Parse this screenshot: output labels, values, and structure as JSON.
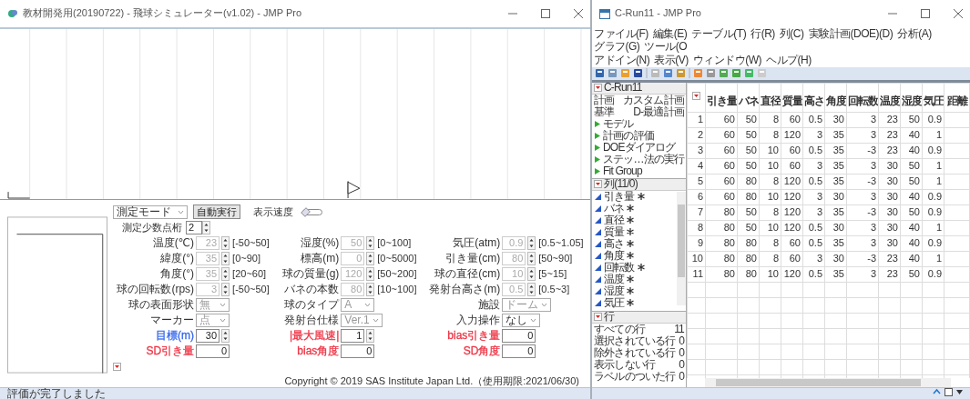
{
  "left_window": {
    "title": "教材開発用(20190722) - 飛球シミュレーター(v1.02) - JMP Pro",
    "toolbar": {
      "mode": "測定モード",
      "auto_run": "自動実行",
      "speed_label": "表示速度",
      "speed": {
        "level": 0.1
      }
    },
    "decimals": {
      "label": "測定少数点桁",
      "value": "2"
    },
    "params": [
      [
        {
          "kind": "spin",
          "label": "温度(℃)",
          "value": "23",
          "range": "[-50~50]",
          "disabled": true
        },
        {
          "kind": "spin",
          "label": "湿度(%)",
          "value": "50",
          "range": "[0~100]",
          "disabled": true
        },
        {
          "kind": "spin",
          "label": "気圧(atm)",
          "value": "0.9",
          "range": "[0.5~1.05]",
          "disabled": true
        }
      ],
      [
        {
          "kind": "spin",
          "label": "緯度(°)",
          "value": "35",
          "range": "[0~90]",
          "disabled": true
        },
        {
          "kind": "spin",
          "label": "標高(m)",
          "value": "0",
          "range": "[0~5000]",
          "disabled": true
        },
        {
          "kind": "spin",
          "label": "引き量(cm)",
          "value": "80",
          "range": "[50~90]",
          "disabled": true
        }
      ],
      [
        {
          "kind": "spin",
          "label": "角度(°)",
          "value": "35",
          "range": "[20~60]",
          "disabled": true
        },
        {
          "kind": "spin",
          "label": "球の質量(g)",
          "value": "120",
          "range": "[50~200]",
          "disabled": true
        },
        {
          "kind": "spin",
          "label": "球の直径(cm)",
          "value": "10",
          "range": "[5~15]",
          "disabled": true
        }
      ],
      [
        {
          "kind": "spin",
          "label": "球の回転数(rps)",
          "value": "3",
          "range": "[-50~50]",
          "disabled": true
        },
        {
          "kind": "spin",
          "label": "バネの本数",
          "value": "80",
          "range": "[10~100]",
          "disabled": true
        },
        {
          "kind": "spin",
          "label": "発射台高さ(m)",
          "value": "0.5",
          "range": "[0.5~3]",
          "disabled": true
        }
      ],
      [
        {
          "kind": "select",
          "label": "球の表面形状",
          "value": "無",
          "disabled": true
        },
        {
          "kind": "select",
          "label": "球のタイプ",
          "value": "A",
          "disabled": true
        },
        {
          "kind": "select",
          "label": "施設",
          "value": "ドーム",
          "disabled": true
        }
      ],
      [
        {
          "kind": "select",
          "label": "マーカー",
          "value": "点",
          "disabled": true
        },
        {
          "kind": "select",
          "label": "発射台仕様",
          "value": "Ver.1",
          "disabled": true
        },
        {
          "kind": "select",
          "label": "入力操作",
          "value": "なし",
          "disabled": false
        }
      ],
      [
        {
          "kind": "spin",
          "label": "目標(m)",
          "value": "30",
          "disabled": false,
          "color": "#3366ee"
        },
        {
          "kind": "spin",
          "label": "|最大風速|",
          "value": "1",
          "disabled": false,
          "color": "#ee3344"
        },
        {
          "kind": "text",
          "label": "bias引き量",
          "value": "0",
          "disabled": false,
          "color": "#ee3344"
        }
      ],
      [
        {
          "kind": "text",
          "label": "SD引き量",
          "value": "0",
          "disabled": false,
          "color": "#ee3344"
        },
        {
          "kind": "text",
          "label": "bias角度",
          "value": "0",
          "disabled": false,
          "color": "#ee3344"
        },
        {
          "kind": "text",
          "label": "SD角度",
          "value": "0",
          "disabled": false,
          "color": "#ee3344"
        }
      ]
    ],
    "copyright": "Copyright © 2019 SAS Institute Japan Ltd.（使用期限:2021/06/30)",
    "status": "評価が完了しました"
  },
  "right_window": {
    "title": "C-Run11 - JMP Pro",
    "menu_rows": [
      [
        "ファイル(F)",
        "編集(E)",
        "テーブル(T)",
        "行(R)",
        "列(C)",
        "実験計画(DOE)(D)",
        "分析(A)",
        "グラフ(G)",
        "ツール(O"
      ],
      [
        "アドイン(N)",
        "表示(V)",
        "ウィンドウ(W)",
        "ヘルプ(H)"
      ]
    ],
    "table_panel": {
      "title": "C-Run11",
      "properties": [
        {
          "key": "計画",
          "value": "カスタム計画"
        },
        {
          "key": "基準",
          "value": "D-最適計画"
        }
      ],
      "scripts": [
        "モデル",
        "計画の評価",
        "DOEダイアログ",
        "ステッ…法の実行",
        "Fit Group"
      ]
    },
    "columns_panel": {
      "title": "列(11/0)",
      "columns": [
        "引き量",
        "バネ",
        "直径",
        "質量",
        "高さ",
        "角度",
        "回転数",
        "温度",
        "湿度",
        "気圧"
      ]
    },
    "rows_panel": {
      "title": "行",
      "counts": [
        {
          "label": "すべての行",
          "value": "11"
        },
        {
          "label": "選択されている行",
          "value": "0"
        },
        {
          "label": "除外されている行",
          "value": "0"
        },
        {
          "label": "表示しない行",
          "value": "0"
        },
        {
          "label": "ラベルのついた行",
          "value": "0"
        }
      ]
    },
    "grid": {
      "columns": [
        "引き量",
        "バネ",
        "直径",
        "質量",
        "高さ",
        "角度",
        "回転数",
        "温度",
        "湿度",
        "気圧",
        "距離"
      ],
      "rows": [
        {
          "number": "1",
          "cells": [
            "60",
            "50",
            "8",
            "60",
            "0.5",
            "30",
            "3",
            "23",
            "50",
            "0.9"
          ]
        },
        {
          "number": "2",
          "cells": [
            "60",
            "50",
            "8",
            "120",
            "3",
            "35",
            "3",
            "23",
            "40",
            "1"
          ]
        },
        {
          "number": "3",
          "cells": [
            "60",
            "50",
            "10",
            "60",
            "0.5",
            "35",
            "-3",
            "23",
            "40",
            "0.9"
          ]
        },
        {
          "number": "4",
          "cells": [
            "60",
            "50",
            "10",
            "60",
            "3",
            "35",
            "3",
            "30",
            "50",
            "1"
          ]
        },
        {
          "number": "5",
          "cells": [
            "60",
            "80",
            "8",
            "120",
            "0.5",
            "35",
            "-3",
            "30",
            "50",
            "1"
          ]
        },
        {
          "number": "6",
          "cells": [
            "60",
            "80",
            "10",
            "120",
            "3",
            "30",
            "3",
            "30",
            "40",
            "0.9"
          ]
        },
        {
          "number": "7",
          "cells": [
            "80",
            "50",
            "8",
            "120",
            "3",
            "35",
            "-3",
            "30",
            "50",
            "0.9"
          ]
        },
        {
          "number": "8",
          "cells": [
            "80",
            "50",
            "10",
            "120",
            "0.5",
            "30",
            "3",
            "30",
            "40",
            "1"
          ]
        },
        {
          "number": "9",
          "cells": [
            "80",
            "80",
            "8",
            "60",
            "0.5",
            "35",
            "3",
            "30",
            "40",
            "0.9"
          ]
        },
        {
          "number": "10",
          "cells": [
            "80",
            "80",
            "8",
            "60",
            "3",
            "30",
            "-3",
            "23",
            "40",
            "1"
          ]
        },
        {
          "number": "11",
          "cells": [
            "80",
            "80",
            "10",
            "120",
            "0.5",
            "35",
            "3",
            "23",
            "50",
            "0.9"
          ]
        }
      ]
    }
  }
}
